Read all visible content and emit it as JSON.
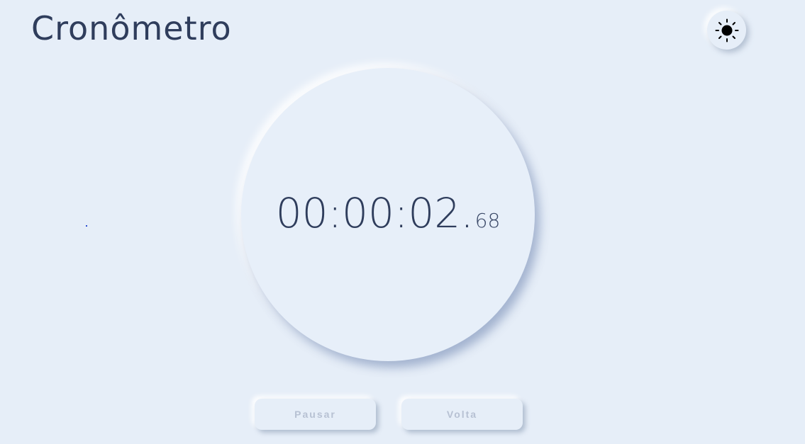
{
  "header": {
    "title": "Cronômetro"
  },
  "theme_toggle": {
    "icon": "sun-icon"
  },
  "stopwatch": {
    "main": "00:00:02.",
    "ms": "68"
  },
  "controls": {
    "pause_label": "Pausar",
    "lap_label": "Volta"
  },
  "colors": {
    "background": "#e6eef8",
    "text": "#2f3d5c",
    "button_text": "#b7c1d3"
  }
}
